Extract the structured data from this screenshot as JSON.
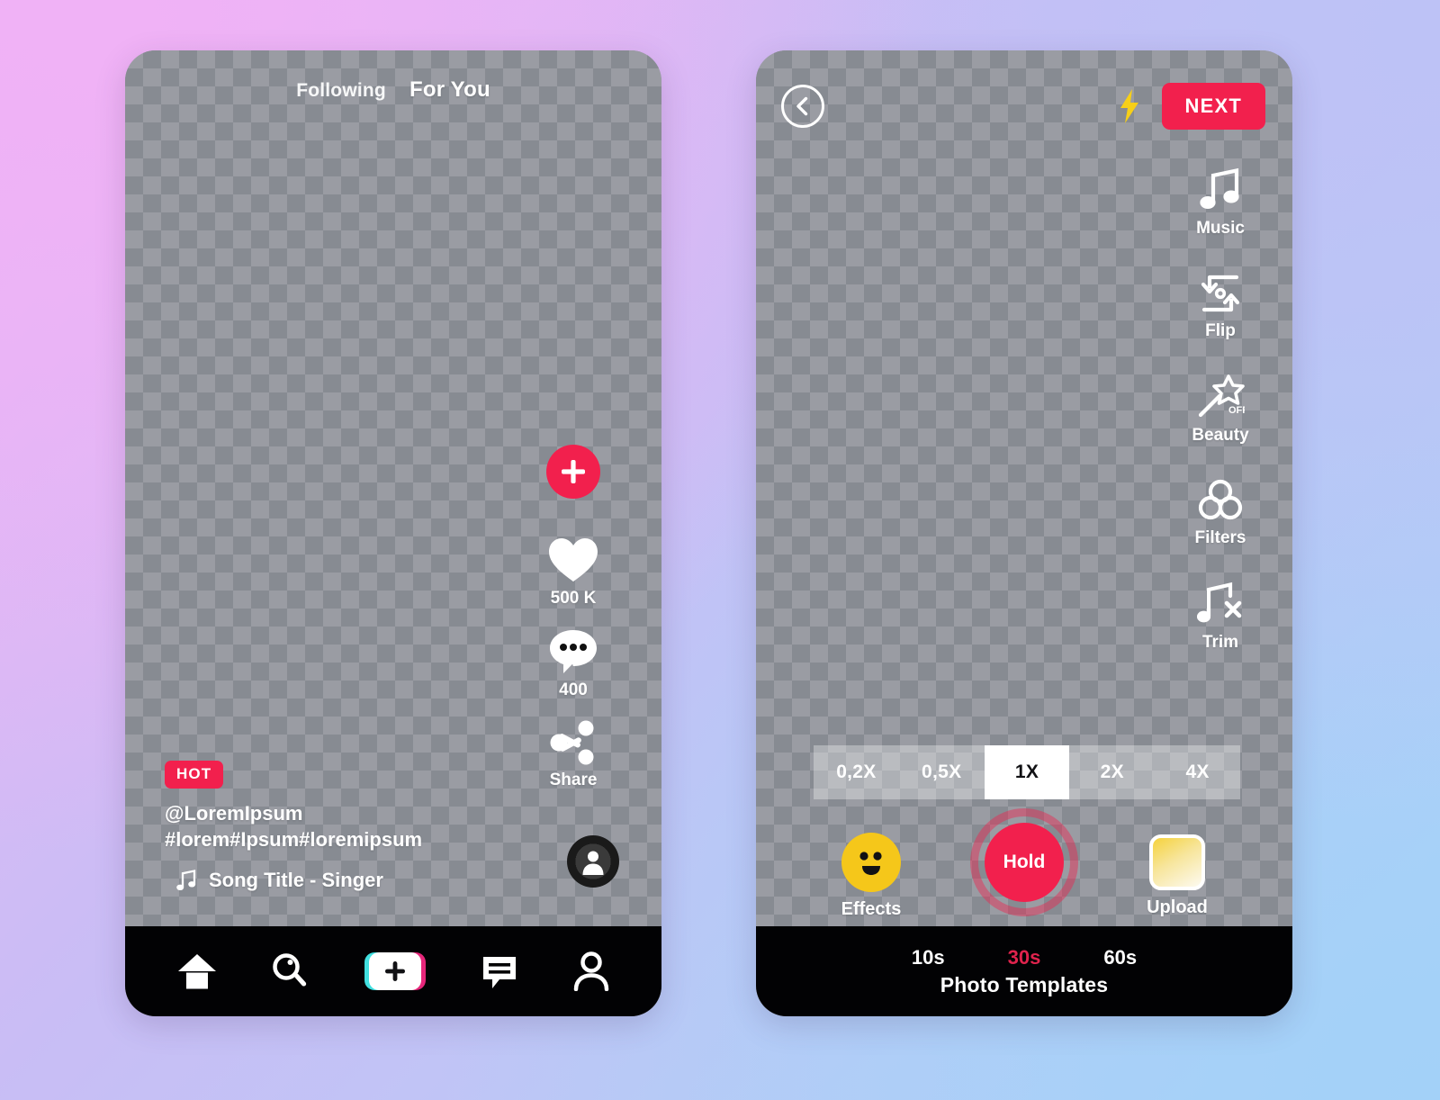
{
  "background": {
    "gradient_start": "#eeb4f5",
    "gradient_mid": "#c9bdf5",
    "gradient_end": "#aed4f7"
  },
  "theme": {
    "accent_red": "#f2204d",
    "accent_red_dark": "#e0234d",
    "nav_black": "#020204",
    "yellow": "#f5c71a",
    "white": "#ffffff"
  },
  "feed_screen": {
    "tabs": {
      "following": "Following",
      "for_you": "For You"
    },
    "actions": {
      "add_icon": "plus-icon",
      "like": {
        "icon": "heart-icon",
        "count": "500 K"
      },
      "comment": {
        "icon": "comment-bubble-icon",
        "count": "400"
      },
      "share": {
        "icon": "share-icon",
        "label": "Share"
      }
    },
    "avatar": {
      "icon": "person-avatar-icon"
    },
    "caption": {
      "badge": "HOT",
      "handle": "@LoremIpsum",
      "hashtags": "#lorem#Ipsum#loremipsum",
      "song_icon": "music-note-icon",
      "song": "Song Title - Singer"
    },
    "bottom_nav": [
      {
        "name": "home",
        "icon": "home-icon"
      },
      {
        "name": "discover",
        "icon": "search-icon"
      },
      {
        "name": "create",
        "icon": "plus-box-icon"
      },
      {
        "name": "inbox",
        "icon": "message-icon"
      },
      {
        "name": "profile",
        "icon": "person-icon"
      }
    ]
  },
  "camera_screen": {
    "top_bar": {
      "back_icon": "chevron-left-icon",
      "flash_icon": "lightning-bolt-icon",
      "next_label": "NEXT"
    },
    "tools": [
      {
        "label": "Music",
        "icon": "music-note-icon"
      },
      {
        "label": "Flip",
        "icon": "flip-camera-icon"
      },
      {
        "label": "Beauty",
        "icon": "magic-wand-icon",
        "state": "OFF"
      },
      {
        "label": "Filters",
        "icon": "filters-circles-icon"
      },
      {
        "label": "Trim",
        "icon": "music-note-x-icon"
      }
    ],
    "speed_options": [
      {
        "label": "0,2X",
        "selected": false
      },
      {
        "label": "0,5X",
        "selected": false
      },
      {
        "label": "1X",
        "selected": true
      },
      {
        "label": "2X",
        "selected": false
      },
      {
        "label": "4X",
        "selected": false
      }
    ],
    "capture_row": {
      "effects": {
        "label": "Effects",
        "icon": "smiley-face-icon"
      },
      "record": {
        "label": "Hold"
      },
      "upload": {
        "label": "Upload",
        "icon": "gallery-thumbnail-icon"
      }
    },
    "durations": [
      {
        "label": "10s",
        "selected": false
      },
      {
        "label": "30s",
        "selected": true
      },
      {
        "label": "60s",
        "selected": false
      }
    ],
    "photo_templates_label": "Photo Templates"
  }
}
